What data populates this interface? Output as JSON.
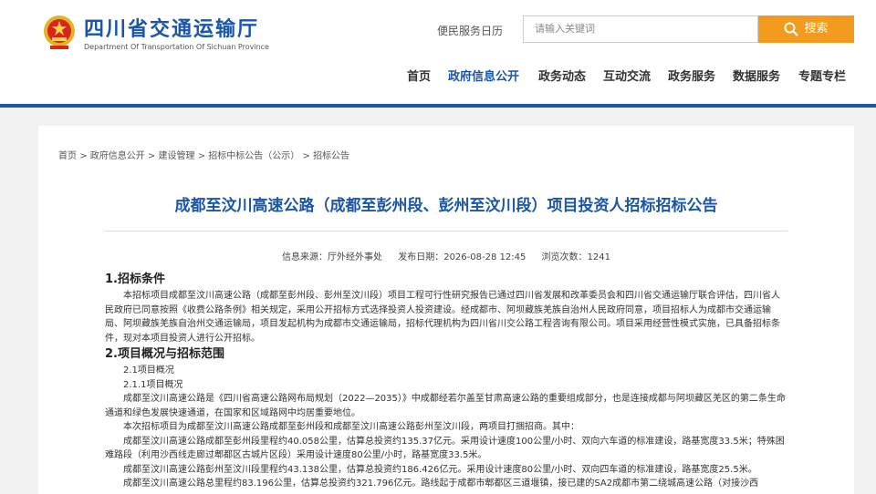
{
  "header": {
    "title": "四川省交通运输厅",
    "subtitle": "Department Of Transportation Of Sichuan Province",
    "calendar_link": "便民服务日历",
    "search_placeholder": "请输入关键词",
    "search_button": "搜索",
    "brand_color": "#1a56a8",
    "accent_color": "#f39b1f"
  },
  "nav": {
    "items": [
      "首页",
      "政府信息公开",
      "政务动态",
      "互动交流",
      "政务服务",
      "数据服务",
      "专题专栏"
    ],
    "active": "政府信息公开"
  },
  "breadcrumb": {
    "items": [
      "首页",
      "政府信息公开",
      "建设管理",
      "招标中标公告（公示）",
      "招标公告"
    ],
    "separator": ">"
  },
  "article": {
    "title": "成都至汶川高速公路（成都至彭州段、彭州至汶川段）项目投资人招标招标公告",
    "source": "信息来源：厅外经外事处",
    "date": "发布日期：2026-08-28 12:45",
    "views": "浏览次数：1241",
    "section1_heading": "1.招标条件",
    "section1_para": "本招标项目成都至汶川高速公路（成都至彭州段、彭州至汶川段）项目工程可行性研究报告已通过四川省发展和改革委员会和四川省交通运输厅联合评估，四川省人民政府已同意按照《收费公路条例》相关规定，采用公开招标方式选择投资人投资建设。经成都市、阿坝藏族羌族自治州人民政府同意，项目招标人为成都市交通运输局、阿坝藏族羌族自治州交通运输局，项目发起机构为成都市交通运输局，招标代理机构为四川省川交公路工程咨询有限公司。项目采用经营性模式实施，已具备招标条件，现对本项目投资人进行公开招标。",
    "section2_heading": "2.项目概况与招标范围",
    "sub1": "2.1项目概况",
    "sub2": "2.1.1项目概况",
    "para2": "成都至汶川高速公路是《四川省高速公路网布局规划（2022—2035）》中成都经若尔盖至甘肃高速公路的重要组成部分，也是连接成都与阿坝藏区羌区的第二条生命通道和绿色发展快速通道，在国家和区域路网中均居重要地位。",
    "para3": "本次招标项目为成都至汶川高速公路成都至彭州段和成都至汶川高速公路彭州至汶川段，两项目打捆招商。其中：",
    "para4": "成都至汶川高速公路成都至彭州段里程约40.058公里，估算总投资约135.37亿元。采用设计速度100公里/小时、双向六车道的标准建设，路基宽度33.5米；特殊困难路段（利用沙西线走廊过郫都区古城片区段）采用设计速度80公里/小时，路基宽度33.5米。",
    "para5": "成都至汶川高速公路彭州至汶川段里程约43.138公里，估算总投资约186.426亿元。采用设计速度80公里/小时、双向四车道的标准建设，路基宽度25.5米。",
    "para6": "成都至汶川高速公路总里程约83.196公里，估算总投资约321.796亿元。路线起于成都市郫都区三道堰镇，接已建的SA2成都市第二绕城高速公路（对接沙西"
  }
}
